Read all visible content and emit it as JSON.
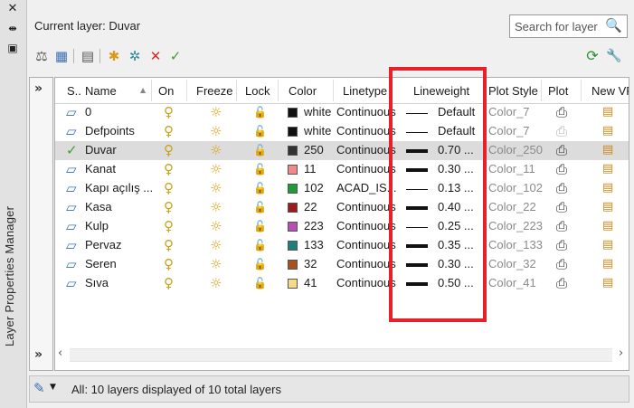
{
  "palette": {
    "close_glyph": "✕",
    "autohide_glyph": "⇹",
    "properties_glyph": "▣",
    "vertical_title": "Layer Properties Manager"
  },
  "header": {
    "current_layer_label": "Current layer: Duvar",
    "search_placeholder": "Search for layer"
  },
  "grid": {
    "columns": [
      "S..",
      "Name",
      "On",
      "Freeze",
      "Lock",
      "Color",
      "Linetype",
      "Lineweight",
      "Plot Style",
      "Plot",
      "New VP"
    ],
    "rows": [
      {
        "name": "0",
        "color_name": "white",
        "color_hex": "#111111",
        "linetype": "Continuous",
        "lineweight": "Default",
        "plot_style": "Color_7",
        "current": false,
        "thick": false,
        "plot_gray": false
      },
      {
        "name": "Defpoints",
        "color_name": "white",
        "color_hex": "#111111",
        "linetype": "Continuous",
        "lineweight": "Default",
        "plot_style": "Color_7",
        "current": false,
        "thick": false,
        "plot_gray": true
      },
      {
        "name": "Duvar",
        "color_name": "250",
        "color_hex": "#333333",
        "linetype": "Continuous",
        "lineweight": "0.70 ...",
        "plot_style": "Color_250",
        "current": true,
        "thick": true,
        "plot_gray": false
      },
      {
        "name": "Kanat",
        "color_name": "11",
        "color_hex": "#f08a8a",
        "linetype": "Continuous",
        "lineweight": "0.30 ...",
        "plot_style": "Color_11",
        "current": false,
        "thick": true,
        "plot_gray": false
      },
      {
        "name": "Kapı açılış ...",
        "color_name": "102",
        "color_hex": "#1f9a3a",
        "linetype": "ACAD_IS...",
        "lineweight": "0.13 ...",
        "plot_style": "Color_102",
        "current": false,
        "thick": false,
        "plot_gray": false
      },
      {
        "name": "Kasa",
        "color_name": "22",
        "color_hex": "#9a1c1c",
        "linetype": "Continuous",
        "lineweight": "0.40 ...",
        "plot_style": "Color_22",
        "current": false,
        "thick": true,
        "plot_gray": false
      },
      {
        "name": "Kulp",
        "color_name": "223",
        "color_hex": "#b64fb0",
        "linetype": "Continuous",
        "lineweight": "0.25 ...",
        "plot_style": "Color_223",
        "current": false,
        "thick": false,
        "plot_gray": false
      },
      {
        "name": "Pervaz",
        "color_name": "133",
        "color_hex": "#1e7f7f",
        "linetype": "Continuous",
        "lineweight": "0.35 ...",
        "plot_style": "Color_133",
        "current": false,
        "thick": true,
        "plot_gray": false
      },
      {
        "name": "Seren",
        "color_name": "32",
        "color_hex": "#a8501e",
        "linetype": "Continuous",
        "lineweight": "0.30 ...",
        "plot_style": "Color_32",
        "current": false,
        "thick": true,
        "plot_gray": false
      },
      {
        "name": "Sıva",
        "color_name": "41",
        "color_hex": "#f7d98a",
        "linetype": "Continuous",
        "lineweight": "0.50 ...",
        "plot_style": "Color_41",
        "current": false,
        "thick": true,
        "plot_gray": false
      }
    ]
  },
  "status": {
    "text": "All: 10 layers displayed of 10 total layers"
  },
  "icons": {
    "layer": "▱",
    "current": "✓",
    "on": "♀",
    "freeze": "☼",
    "lock": "🔓",
    "plot": "⎙",
    "newvp": "▤",
    "search": "🔍",
    "refresh": "⟳",
    "settings": "🔧",
    "chevron_right": "»",
    "scroll_left": "‹",
    "scroll_right": "›"
  },
  "colors": {
    "highlight": "#e8202a",
    "selected_row": "#dcdcdc",
    "current_check": "#3da12f"
  }
}
